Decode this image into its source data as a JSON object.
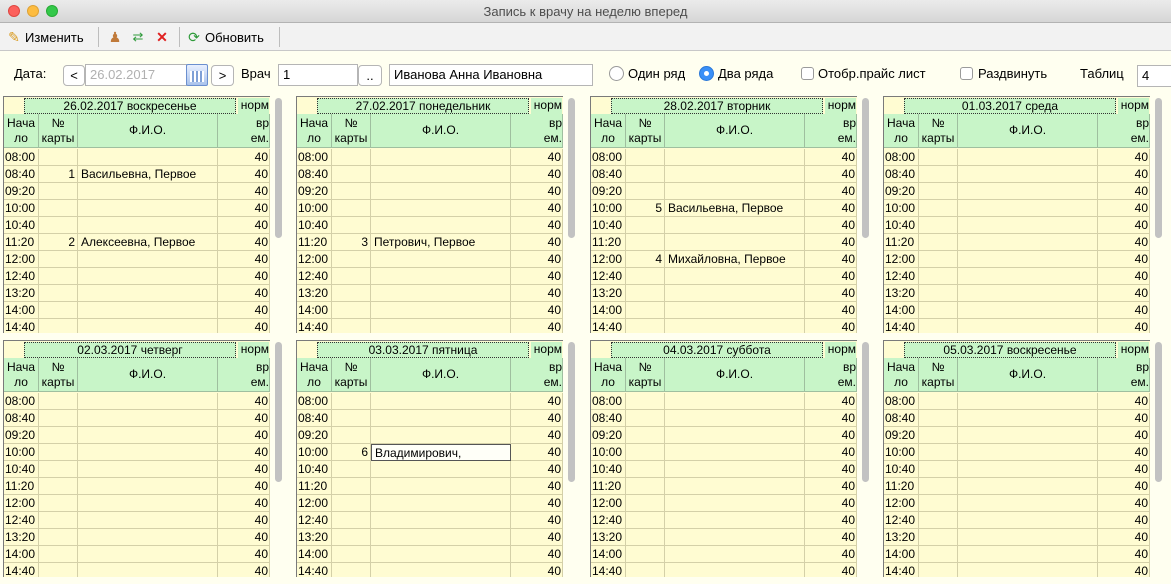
{
  "window": {
    "title": "Запись к врачу на неделю вперед"
  },
  "toolbar": {
    "edit_label": "Изменить",
    "refresh_label": "Обновить"
  },
  "filters": {
    "date_label": "Дата:",
    "prev": "<",
    "next": ">",
    "date_value": "26.02.2017",
    "doctor_label": "Врач",
    "doctor_id": "1",
    "doctor_browse": "..",
    "doctor_name": "Иванова Анна Ивановна",
    "one_row_label": "Один ряд",
    "two_rows_label": "Два ряда",
    "row_mode": "two",
    "price_label": "Отобр.прайс лист",
    "price_checked": false,
    "spread_label": "Раздвинуть",
    "spread_checked": false,
    "tables_label": "Таблиц",
    "tables_value": "4"
  },
  "columns": {
    "time": "Нача ло",
    "card": "№ карты",
    "name": "Ф.И.О.",
    "norm_top": "норм",
    "norm": "вр ем."
  },
  "days": [
    {
      "date": "26.02.2017 воскресенье",
      "rows": [
        [
          "08:00",
          "",
          "",
          "40"
        ],
        [
          "08:40",
          "1",
          "Васильевна, Первое",
          "40"
        ],
        [
          "09:20",
          "",
          "",
          "40"
        ],
        [
          "10:00",
          "",
          "",
          "40"
        ],
        [
          "10:40",
          "",
          "",
          "40"
        ],
        [
          "11:20",
          "2",
          "Алексеевна, Первое",
          "40"
        ],
        [
          "12:00",
          "",
          "",
          "40"
        ],
        [
          "12:40",
          "",
          "",
          "40"
        ],
        [
          "13:20",
          "",
          "",
          "40"
        ],
        [
          "14:00",
          "",
          "",
          "40"
        ],
        [
          "14:40",
          "",
          "",
          "40"
        ]
      ]
    },
    {
      "date": "27.02.2017 понедельник",
      "rows": [
        [
          "08:00",
          "",
          "",
          "40"
        ],
        [
          "08:40",
          "",
          "",
          "40"
        ],
        [
          "09:20",
          "",
          "",
          "40"
        ],
        [
          "10:00",
          "",
          "",
          "40"
        ],
        [
          "10:40",
          "",
          "",
          "40"
        ],
        [
          "11:20",
          "3",
          "Петрович, Первое",
          "40"
        ],
        [
          "12:00",
          "",
          "",
          "40"
        ],
        [
          "12:40",
          "",
          "",
          "40"
        ],
        [
          "13:20",
          "",
          "",
          "40"
        ],
        [
          "14:00",
          "",
          "",
          "40"
        ],
        [
          "14:40",
          "",
          "",
          "40"
        ]
      ]
    },
    {
      "date": "28.02.2017 вторник",
      "rows": [
        [
          "08:00",
          "",
          "",
          "40"
        ],
        [
          "08:40",
          "",
          "",
          "40"
        ],
        [
          "09:20",
          "",
          "",
          "40"
        ],
        [
          "10:00",
          "5",
          "Васильевна, Первое",
          "40"
        ],
        [
          "10:40",
          "",
          "",
          "40"
        ],
        [
          "11:20",
          "",
          "",
          "40"
        ],
        [
          "12:00",
          "4",
          "Михайловна, Первое",
          "40"
        ],
        [
          "12:40",
          "",
          "",
          "40"
        ],
        [
          "13:20",
          "",
          "",
          "40"
        ],
        [
          "14:00",
          "",
          "",
          "40"
        ],
        [
          "14:40",
          "",
          "",
          "40"
        ]
      ]
    },
    {
      "date": "01.03.2017 среда",
      "rows": [
        [
          "08:00",
          "",
          "",
          "40"
        ],
        [
          "08:40",
          "",
          "",
          "40"
        ],
        [
          "09:20",
          "",
          "",
          "40"
        ],
        [
          "10:00",
          "",
          "",
          "40"
        ],
        [
          "10:40",
          "",
          "",
          "40"
        ],
        [
          "11:20",
          "",
          "",
          "40"
        ],
        [
          "12:00",
          "",
          "",
          "40"
        ],
        [
          "12:40",
          "",
          "",
          "40"
        ],
        [
          "13:20",
          "",
          "",
          "40"
        ],
        [
          "14:00",
          "",
          "",
          "40"
        ],
        [
          "14:40",
          "",
          "",
          "40"
        ]
      ]
    },
    {
      "date": "02.03.2017 четверг",
      "rows": [
        [
          "08:00",
          "",
          "",
          "40"
        ],
        [
          "08:40",
          "",
          "",
          "40"
        ],
        [
          "09:20",
          "",
          "",
          "40"
        ],
        [
          "10:00",
          "",
          "",
          "40"
        ],
        [
          "10:40",
          "",
          "",
          "40"
        ],
        [
          "11:20",
          "",
          "",
          "40"
        ],
        [
          "12:00",
          "",
          "",
          "40"
        ],
        [
          "12:40",
          "",
          "",
          "40"
        ],
        [
          "13:20",
          "",
          "",
          "40"
        ],
        [
          "14:00",
          "",
          "",
          "40"
        ],
        [
          "14:40",
          "",
          "",
          "40"
        ]
      ]
    },
    {
      "date": "03.03.2017 пятница",
      "rows": [
        [
          "08:00",
          "",
          "",
          "40"
        ],
        [
          "08:40",
          "",
          "",
          "40"
        ],
        [
          "09:20",
          "",
          "",
          "40"
        ],
        [
          "10:00",
          "6",
          "Владимирович,",
          "40"
        ],
        [
          "10:40",
          "",
          "",
          "40"
        ],
        [
          "11:20",
          "",
          "",
          "40"
        ],
        [
          "12:00",
          "",
          "",
          "40"
        ],
        [
          "12:40",
          "",
          "",
          "40"
        ],
        [
          "13:20",
          "",
          "",
          "40"
        ],
        [
          "14:00",
          "",
          "",
          "40"
        ],
        [
          "14:40",
          "",
          "",
          "40"
        ]
      ]
    },
    {
      "date": "04.03.2017 суббота",
      "rows": [
        [
          "08:00",
          "",
          "",
          "40"
        ],
        [
          "08:40",
          "",
          "",
          "40"
        ],
        [
          "09:20",
          "",
          "",
          "40"
        ],
        [
          "10:00",
          "",
          "",
          "40"
        ],
        [
          "10:40",
          "",
          "",
          "40"
        ],
        [
          "11:20",
          "",
          "",
          "40"
        ],
        [
          "12:00",
          "",
          "",
          "40"
        ],
        [
          "12:40",
          "",
          "",
          "40"
        ],
        [
          "13:20",
          "",
          "",
          "40"
        ],
        [
          "14:00",
          "",
          "",
          "40"
        ],
        [
          "14:40",
          "",
          "",
          "40"
        ]
      ]
    },
    {
      "date": "05.03.2017 воскресенье",
      "rows": [
        [
          "08:00",
          "",
          "",
          "40"
        ],
        [
          "08:40",
          "",
          "",
          "40"
        ],
        [
          "09:20",
          "",
          "",
          "40"
        ],
        [
          "10:00",
          "",
          "",
          "40"
        ],
        [
          "10:40",
          "",
          "",
          "40"
        ],
        [
          "11:20",
          "",
          "",
          "40"
        ],
        [
          "12:00",
          "",
          "",
          "40"
        ],
        [
          "12:40",
          "",
          "",
          "40"
        ],
        [
          "13:20",
          "",
          "",
          "40"
        ],
        [
          "14:00",
          "",
          "",
          "40"
        ],
        [
          "14:40",
          "",
          "",
          "40"
        ]
      ]
    }
  ],
  "selected": {
    "day": 5,
    "row": 3
  }
}
